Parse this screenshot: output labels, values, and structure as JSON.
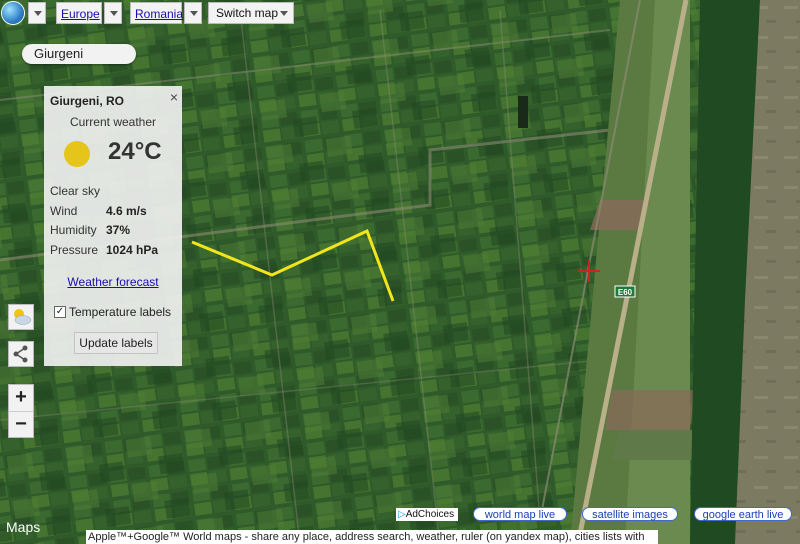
{
  "toolbar": {
    "region_link": "Europe",
    "country_link": "Romania",
    "switch_label": "Switch map"
  },
  "place_label": "Giurgeni",
  "weather": {
    "location": "Giurgeni, RO",
    "close": "×",
    "heading": "Current weather",
    "temperature": "24°C",
    "condition": "Clear sky",
    "rows": [
      {
        "label": "Wind",
        "value": "4.6 m/s"
      },
      {
        "label": "Humidity",
        "value": "37%"
      },
      {
        "label": "Pressure",
        "value": "1024 hPa"
      }
    ],
    "forecast_link": "Weather forecast",
    "temperature_labels": "Temperature labels",
    "temperature_labels_checked": true,
    "update_button": "Update labels"
  },
  "road_label": "E60",
  "zoom": {
    "in": "+",
    "out": "−"
  },
  "map_logo": "Maps",
  "adchoices": "AdChoices",
  "links": [
    "world map live",
    "satellite images",
    "google earth live"
  ],
  "footer_text": "Apple™+Google™ World maps - share any place, address search, weather, ruler (on yandex map), cities lists with",
  "colors": {
    "ruler": "#f2e51c",
    "marker": "#d32020",
    "link": "#1a0dab"
  }
}
